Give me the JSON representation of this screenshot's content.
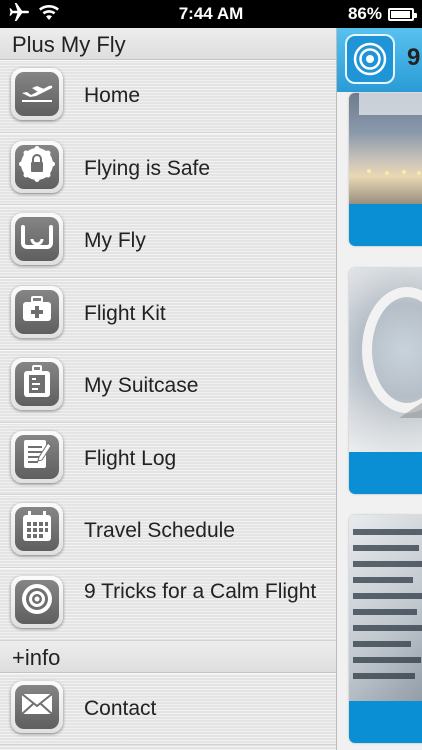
{
  "status_bar": {
    "time": "7:44 AM",
    "battery": "86%",
    "battery_level": 0.86,
    "icons": [
      "airplane-mode-icon",
      "wifi-icon",
      "battery-icon"
    ]
  },
  "menu": {
    "title": "Plus My Fly",
    "items": [
      {
        "label": "Home",
        "icon": "airplane-icon"
      },
      {
        "label": "Flying is Safe",
        "icon": "lock-icon"
      },
      {
        "label": "My Fly",
        "icon": "my-fly-icon"
      },
      {
        "label": "Flight Kit",
        "icon": "first-aid-kit-icon"
      },
      {
        "label": "My Suitcase",
        "icon": "suitcase-icon"
      },
      {
        "label": "Flight Log",
        "icon": "notebook-icon"
      },
      {
        "label": "Travel Schedule",
        "icon": "calendar-icon"
      },
      {
        "label": "9 Tricks for a Calm Flight",
        "icon": "target-icon"
      }
    ],
    "info_section": {
      "title": "+info",
      "items": [
        {
          "label": "Contact",
          "icon": "envelope-icon"
        }
      ]
    }
  },
  "content_peek": {
    "header_text": "9",
    "accent_color": "#0a8fd4",
    "cards": [
      "airport-photo",
      "airplane-window-photo",
      "departure-board-photo"
    ]
  }
}
